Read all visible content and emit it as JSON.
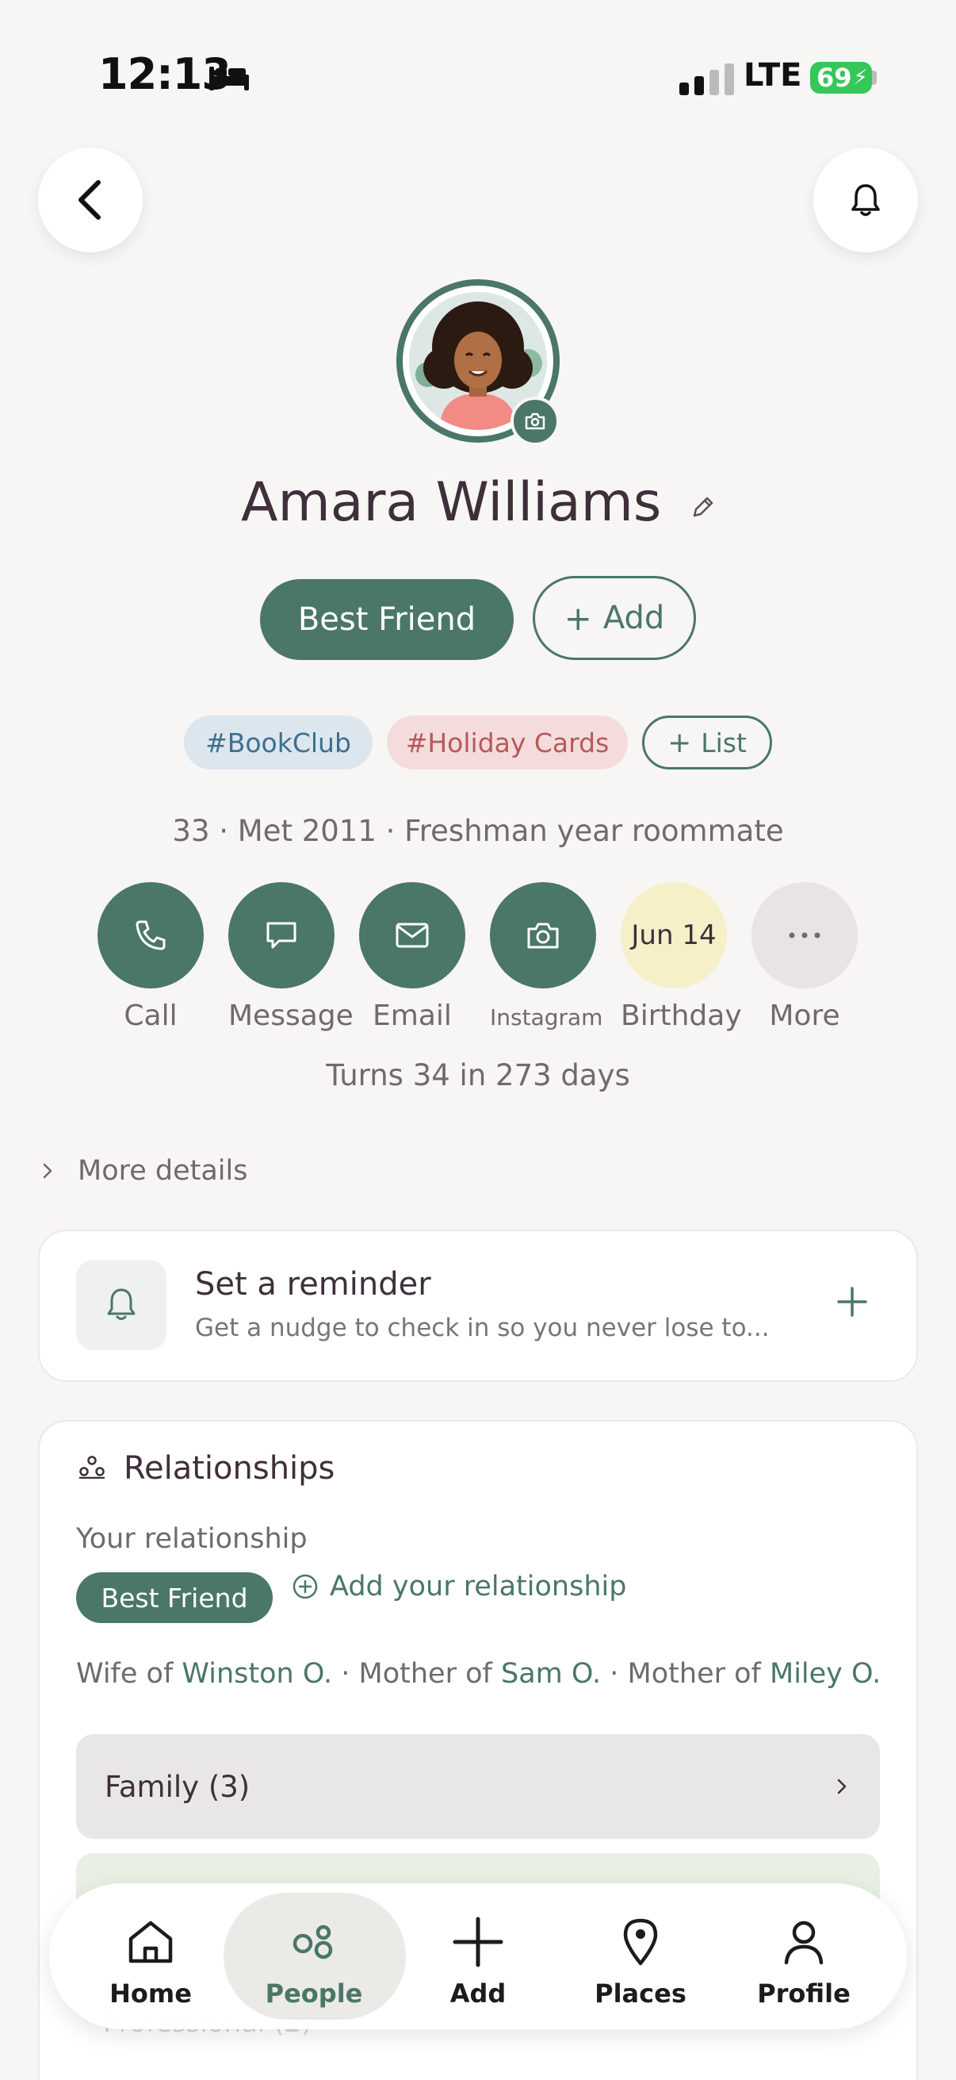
{
  "status_bar": {
    "time": "12:13",
    "carrier": "LTE",
    "battery": "69"
  },
  "contact": {
    "name": "Amara Williams",
    "relationship_badge": "Best Friend",
    "add_label": "Add",
    "tags": [
      "#BookClub",
      "#Holiday Cards"
    ],
    "list_label": "List",
    "meta": "33 · Met 2011 · Freshman year roommate",
    "turns": "Turns 34 in 273 days"
  },
  "actions": [
    {
      "label": "Call",
      "icon": "phone-icon"
    },
    {
      "label": "Message",
      "icon": "message-icon"
    },
    {
      "label": "Email",
      "icon": "mail-icon"
    },
    {
      "label": "Instagram",
      "icon": "camera-icon"
    },
    {
      "label": "Birthday",
      "value": "Jun 14"
    },
    {
      "label": "More",
      "icon": "ellipsis-icon"
    }
  ],
  "more_details": "More details",
  "reminder": {
    "title": "Set a reminder",
    "subtitle": "Get a nudge to check in so you never lose to..."
  },
  "relationships": {
    "title": "Relationships",
    "your_relationship_label": "Your relationship",
    "badge": "Best Friend",
    "add_label": "Add your relationship",
    "relations": [
      {
        "prefix": "Wife of",
        "name": "Winston O."
      },
      {
        "prefix": "Mother of",
        "name": "Sam O."
      },
      {
        "prefix": "Mother of",
        "name": "Miley O."
      }
    ],
    "family_row": "Family (3)",
    "professional_row": "Professional (2)"
  },
  "nav": [
    {
      "label": "Home",
      "icon": "home-icon"
    },
    {
      "label": "People",
      "icon": "people-icon",
      "active": true
    },
    {
      "label": "Add",
      "icon": "plus-icon"
    },
    {
      "label": "Places",
      "icon": "location-pin-icon"
    },
    {
      "label": "Profile",
      "icon": "person-icon"
    }
  ],
  "colors": {
    "accent": "#4A7767",
    "background": "#F7F6F4",
    "birthday": "#F6F0C9"
  }
}
